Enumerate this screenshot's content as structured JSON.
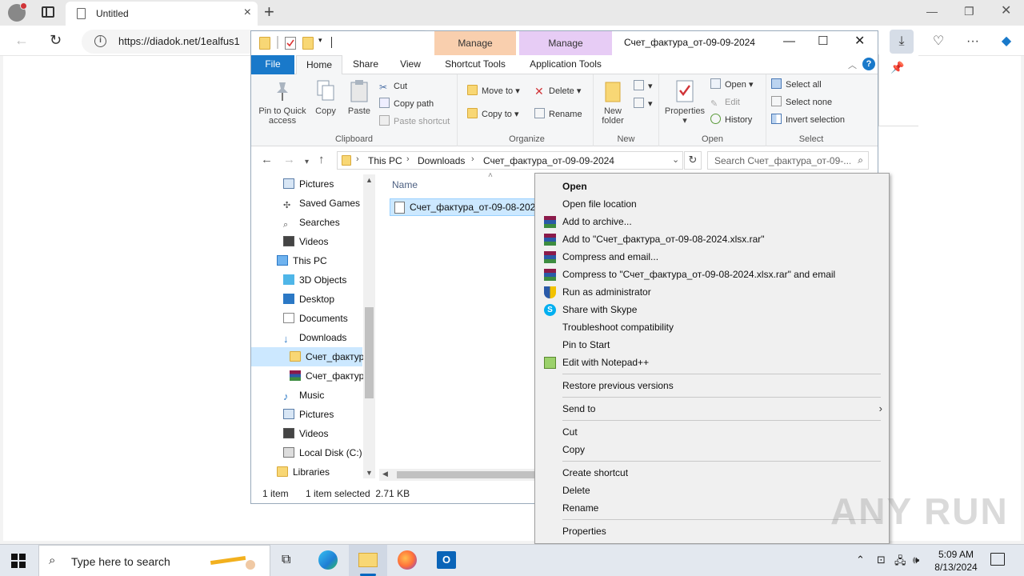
{
  "browser": {
    "tab_title": "Untitled",
    "url": "https://diadok.net/1ealfus1"
  },
  "explorer": {
    "window_title": "Счет_фактура_от-09-09-2024",
    "contextual_tabs": [
      {
        "group": "Manage",
        "tab": "Shortcut Tools",
        "color": "#f9cfae"
      },
      {
        "group": "Manage",
        "tab": "Application Tools",
        "color": "#e7ccf5"
      }
    ],
    "ribbon_tabs": [
      "File",
      "Home",
      "Share",
      "View"
    ],
    "clipboard": {
      "label": "Clipboard",
      "pin_label_1": "Pin to Quick",
      "pin_label_2": "access",
      "copy": "Copy",
      "paste": "Paste",
      "cut": "Cut",
      "copy_path": "Copy path",
      "paste_shortcut": "Paste shortcut"
    },
    "organize": {
      "label": "Organize",
      "move_to": "Move to",
      "copy_to": "Copy to",
      "delete": "Delete",
      "rename": "Rename"
    },
    "new": {
      "label": "New",
      "new_folder_1": "New",
      "new_folder_2": "folder"
    },
    "open": {
      "label": "Open",
      "properties": "Properties",
      "open": "Open",
      "edit": "Edit",
      "history": "History"
    },
    "select": {
      "label": "Select",
      "select_all": "Select all",
      "select_none": "Select none",
      "invert": "Invert selection"
    },
    "breadcrumb": [
      "This PC",
      "Downloads",
      "Счет_фактура_от-09-09-2024"
    ],
    "search_placeholder": "Search Счет_фактура_от-09-...",
    "nav_items": [
      {
        "label": "Pictures",
        "icon": "pictures"
      },
      {
        "label": "Saved Games",
        "icon": "games"
      },
      {
        "label": "Searches",
        "icon": "search"
      },
      {
        "label": "Videos",
        "icon": "videos"
      },
      {
        "label": "This PC",
        "icon": "pc"
      },
      {
        "label": "3D Objects",
        "icon": "3d"
      },
      {
        "label": "Desktop",
        "icon": "desktop"
      },
      {
        "label": "Documents",
        "icon": "documents"
      },
      {
        "label": "Downloads",
        "icon": "downloads"
      },
      {
        "label": "Счет_фактур",
        "icon": "folder"
      },
      {
        "label": "Счет_фактур",
        "icon": "rar"
      },
      {
        "label": "Music",
        "icon": "music"
      },
      {
        "label": "Pictures",
        "icon": "pictures"
      },
      {
        "label": "Videos",
        "icon": "videos"
      },
      {
        "label": "Local Disk (C:)",
        "icon": "disk"
      },
      {
        "label": "Libraries",
        "icon": "libraries"
      }
    ],
    "column_name": "Name",
    "file_name": "Счет_фактура_от-09-08-2024",
    "status_count": "1 item",
    "status_selected": "1 item selected  2.71 KB"
  },
  "context_menu": {
    "items": [
      "Open",
      "Open file location",
      "Add to archive...",
      "Add to \"Счет_фактура_от-09-08-2024.xlsx.rar\"",
      "Compress and email...",
      "Compress to \"Счет_фактура_от-09-08-2024.xlsx.rar\" and email",
      "Run as administrator",
      "Share with Skype",
      "Troubleshoot compatibility",
      "Pin to Start",
      "Edit with Notepad++",
      "Restore previous versions",
      "Send to",
      "Cut",
      "Copy",
      "Create shortcut",
      "Delete",
      "Rename",
      "Properties"
    ]
  },
  "taskbar": {
    "search_placeholder": "Type here to search",
    "time": "5:09 AM",
    "date": "8/13/2024"
  },
  "watermark": "ANY RUN"
}
